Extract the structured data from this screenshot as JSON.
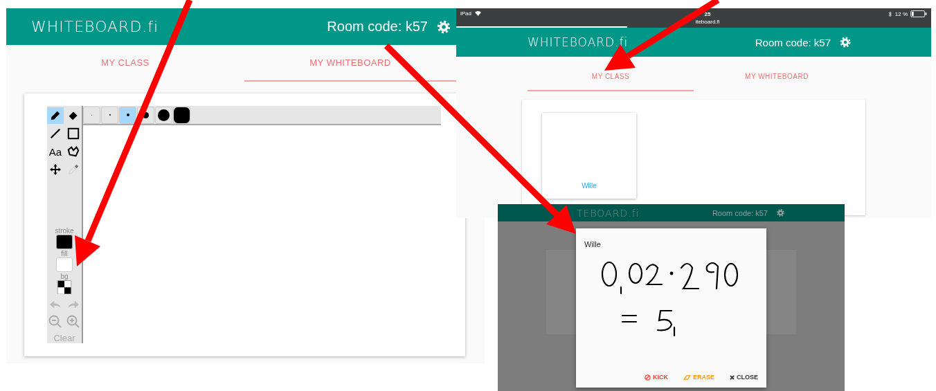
{
  "desktop_view": {
    "header": {
      "logo": "WHITEBOARD.fi",
      "room_code": "Room code: k57"
    },
    "tabs": [
      {
        "label": "MY CLASS",
        "selected": false
      },
      {
        "label": "MY WHITEBOARD",
        "selected": true
      }
    ],
    "tools": [
      {
        "kind": "pencil",
        "selected": true,
        "disabled": false
      },
      {
        "kind": "eraser",
        "selected": false,
        "disabled": false
      },
      {
        "kind": "line",
        "selected": false,
        "disabled": false
      },
      {
        "kind": "rectangle",
        "selected": false,
        "disabled": false
      },
      {
        "kind": "text",
        "label": "Aa",
        "selected": false,
        "disabled": false
      },
      {
        "kind": "polygon",
        "selected": false,
        "disabled": false
      },
      {
        "kind": "move",
        "selected": false,
        "disabled": false
      },
      {
        "kind": "eyedropper",
        "selected": false,
        "disabled": true
      }
    ],
    "brush_sizes": [
      {
        "selected": false
      },
      {
        "selected": false
      },
      {
        "selected": true
      },
      {
        "selected": false
      },
      {
        "selected": false
      },
      {
        "selected": false
      }
    ],
    "stroke_label": "stroke",
    "fill_label": "fill",
    "bg_label": "bg",
    "clear_button": {
      "label": "Clear",
      "disabled": true
    }
  },
  "tablet_view": {
    "status_bar": {
      "carrier": "iPad",
      "time": "25",
      "url": "iteboard.fi",
      "battery": "12 %"
    },
    "page_load": {
      "level": 0.36
    },
    "header": {
      "logo": "WHITEBOARD.fi",
      "room_code": "Room code: k57"
    },
    "tabs": [
      {
        "label": "MY CLASS",
        "selected": true
      },
      {
        "label": "MY WHITEBOARD",
        "selected": false
      }
    ],
    "students": [
      {
        "name": "Wille"
      }
    ]
  },
  "dialog_view": {
    "header": {
      "logo": "TEBOARD.fi",
      "room_code": "Room code: k57"
    },
    "dialog": {
      "title": "Wille",
      "actions": [
        {
          "kind": "kick",
          "label": "KICK",
          "color": "#f44336"
        },
        {
          "kind": "erase",
          "label": "ERASE",
          "color": "#ff9800"
        },
        {
          "kind": "close",
          "label": "CLOSE",
          "color": "#333333"
        }
      ]
    }
  }
}
